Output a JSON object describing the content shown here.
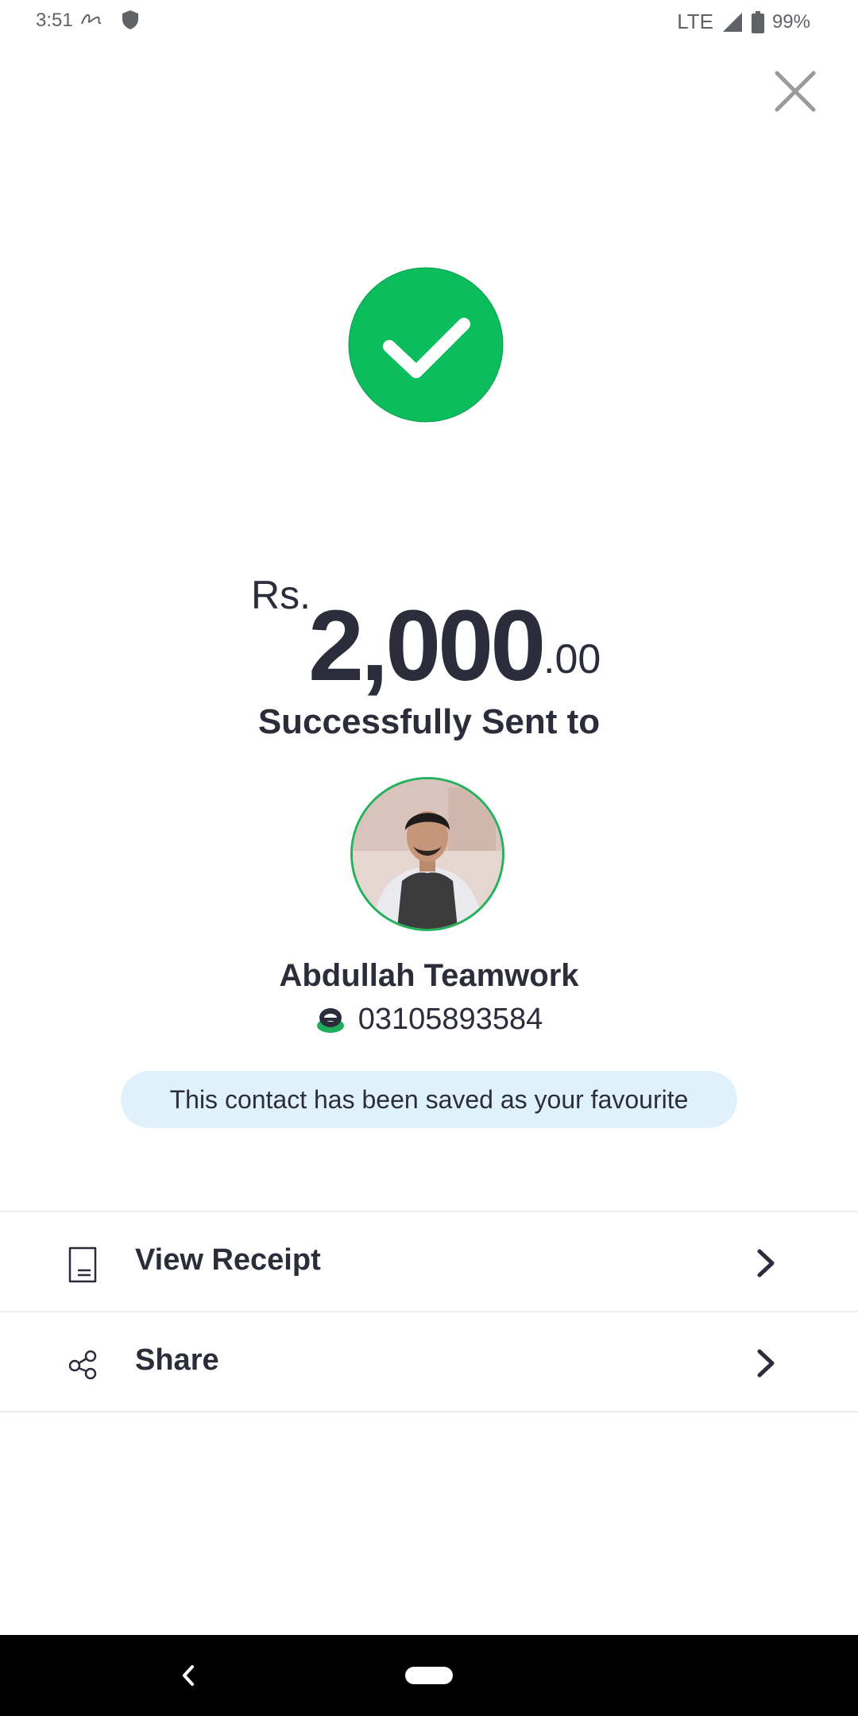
{
  "status_bar": {
    "time": "3:51",
    "network": "LTE",
    "battery": "99%"
  },
  "transaction": {
    "currency": "Rs.",
    "amount_main": "2,000",
    "amount_cents": ".00",
    "status_text": "Successfully Sent to"
  },
  "recipient": {
    "name": "Abdullah Teamwork",
    "number": "03105893584"
  },
  "banner": {
    "text": "This contact has been saved as your favourite"
  },
  "actions": [
    {
      "label": "View Receipt",
      "icon": "receipt-icon"
    },
    {
      "label": "Share",
      "icon": "share-icon"
    }
  ],
  "colors": {
    "success_green": "#0bbd5c",
    "avatar_border": "#23b15a",
    "banner_bg": "#dff2fb",
    "text_dark": "#2b2d3b"
  }
}
